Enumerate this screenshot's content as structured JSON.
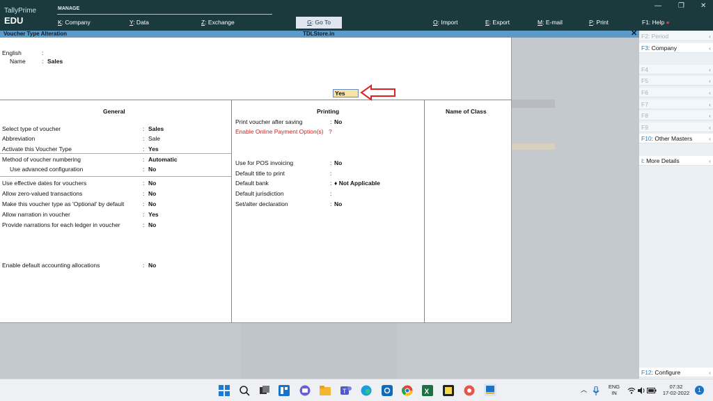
{
  "app": {
    "brand_line1": "TallyPrime",
    "brand_line2": "EDU",
    "manage_label": "MANAGE"
  },
  "menu": [
    {
      "key": "K",
      "label": ": Company"
    },
    {
      "key": "Y",
      "label": ": Data"
    },
    {
      "key": "Z",
      "label": ": Exchange"
    },
    {
      "key": "G",
      "label": ": Go To"
    },
    {
      "key": "O",
      "label": ": Import"
    },
    {
      "key": "E",
      "label": ": Export"
    },
    {
      "key": "M",
      "label": ": E-mail"
    },
    {
      "key": "P",
      "label": ": Print"
    },
    {
      "key": "F1",
      "label": ": Help"
    }
  ],
  "window": {
    "title": "Voucher Type Alteration",
    "company": "TDLStore.in",
    "close": "✕"
  },
  "header": {
    "english_label": "English",
    "english_colon": ":",
    "name_label": "Name",
    "name_colon": ":",
    "name_value": "Sales"
  },
  "general": {
    "title": "General",
    "rows": [
      {
        "label": "Select type of voucher",
        "sep": ":",
        "value": "Sales",
        "bold": true
      },
      {
        "label": "Abbreviation",
        "sep": ":",
        "value": "Sale",
        "bold": false
      },
      {
        "label": "Activate this Voucher Type",
        "sep": ":",
        "value": "Yes",
        "bold": true
      },
      {
        "label": "Method of voucher numbering",
        "sep": ":",
        "value": "Automatic",
        "bold": true
      },
      {
        "label": "Use advanced configuration",
        "sep": ":",
        "value": "No",
        "bold": true
      },
      {
        "label": "Use effective dates for vouchers",
        "sep": ":",
        "value": "No",
        "bold": true
      },
      {
        "label": "Allow zero-valued transactions",
        "sep": ":",
        "value": "No",
        "bold": true
      },
      {
        "label": "Make this voucher type as 'Optional' by default",
        "sep": ":",
        "value": "No",
        "bold": true
      },
      {
        "label": "Allow narration in voucher",
        "sep": ":",
        "value": "Yes",
        "bold": true
      },
      {
        "label": "Provide narrations for each ledger in voucher",
        "sep": ":",
        "value": "No",
        "bold": true
      },
      {
        "label": "Enable default accounting allocations",
        "sep": ":",
        "value": "No",
        "bold": true
      }
    ]
  },
  "printing": {
    "title": "Printing",
    "rows": [
      {
        "label": "Print voucher after saving",
        "sep": ":",
        "value": "No"
      },
      {
        "label": "Enable Online Payment Option(s)",
        "sep": "?",
        "value": "Yes"
      },
      {
        "label": "Use for POS invoicing",
        "sep": ":",
        "value": "No"
      },
      {
        "label": "Default title to print",
        "sep": ":",
        "value": ""
      },
      {
        "label": "Default bank",
        "sep": ":",
        "value": "♦ Not Applicable"
      },
      {
        "label": "Default jurisdiction",
        "sep": ":",
        "value": ""
      },
      {
        "label": "Set/alter declaration",
        "sep": ":",
        "value": "No"
      }
    ]
  },
  "name_of_class": {
    "title": "Name of Class"
  },
  "sidebar": {
    "items": [
      {
        "key": "F2",
        "label": ": Period",
        "enabled": false
      },
      {
        "key": "F3",
        "label": ": Company",
        "enabled": true
      },
      {
        "key": "F4",
        "label": "",
        "enabled": false
      },
      {
        "key": "F5",
        "label": "",
        "enabled": false
      },
      {
        "key": "F6",
        "label": "",
        "enabled": false
      },
      {
        "key": "F7",
        "label": "",
        "enabled": false
      },
      {
        "key": "F8",
        "label": "",
        "enabled": false
      },
      {
        "key": "F9",
        "label": "",
        "enabled": false
      },
      {
        "key": "F10",
        "label": ": Other Masters",
        "enabled": true
      },
      {
        "key": "I",
        "label": ": More Details",
        "enabled": true
      },
      {
        "key": "F12",
        "label": ": Configure",
        "enabled": true
      }
    ]
  },
  "taskbar": {
    "lang1": "ENG",
    "lang2": "IN",
    "time": "07:32",
    "date": "17-02-2022",
    "badge": "1"
  },
  "colors": {
    "topbar": "#1a3a3e",
    "titlebar": "#5b9ac9",
    "highlight": "#f5e3a8",
    "arrow": "#e02020",
    "label_red": "#d02020"
  }
}
